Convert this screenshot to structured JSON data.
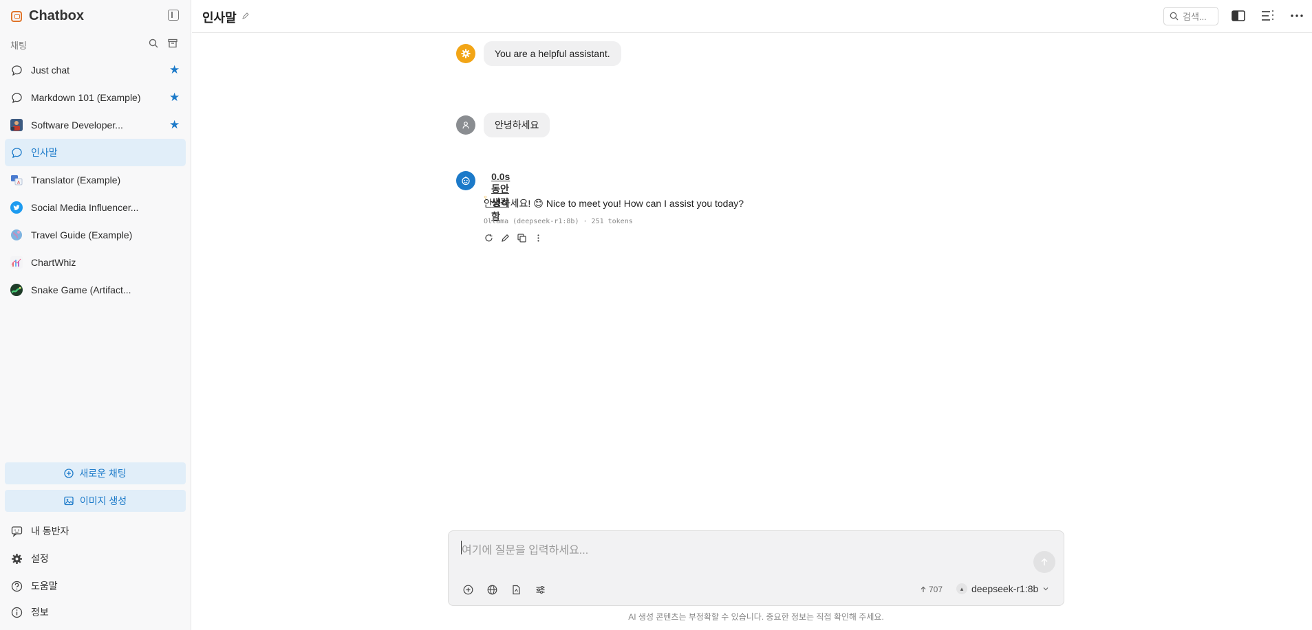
{
  "app": {
    "name": "Chatbox"
  },
  "sidebar": {
    "section_label": "채팅",
    "chats": [
      {
        "label": "Just chat",
        "icon": "chat-bubble-icon",
        "starred": true,
        "active": false
      },
      {
        "label": "Markdown 101 (Example)",
        "icon": "chat-bubble-icon",
        "starred": true,
        "active": false
      },
      {
        "label": "Software Developer...",
        "icon": "developer-avatar-icon",
        "starred": true,
        "active": false
      },
      {
        "label": "인사말",
        "icon": "chat-bubble-icon",
        "starred": false,
        "active": true
      },
      {
        "label": "Translator (Example)",
        "icon": "translator-avatar-icon",
        "starred": false,
        "active": false
      },
      {
        "label": "Social Media Influencer...",
        "icon": "twitter-avatar-icon",
        "starred": false,
        "active": false
      },
      {
        "label": "Travel Guide (Example)",
        "icon": "globe-avatar-icon",
        "starred": false,
        "active": false
      },
      {
        "label": "ChartWhiz",
        "icon": "chart-avatar-icon",
        "starred": false,
        "active": false
      },
      {
        "label": "Snake Game (Artifact...",
        "icon": "snake-avatar-icon",
        "starred": false,
        "active": false
      }
    ],
    "new_chat_label": "새로운 채팅",
    "image_gen_label": "이미지 생성",
    "bottom": {
      "companions": "내 동반자",
      "settings": "설정",
      "help": "도움말",
      "about": "정보"
    }
  },
  "header": {
    "title": "인사말",
    "search_placeholder": "검색..."
  },
  "messages": {
    "system": "You are a helpful assistant.",
    "user": "안녕하세요",
    "assistant": {
      "thinking": "0.0s 동안 생각함",
      "reply_prefix": "안녕하세요!",
      "reply_emoji": "😊",
      "reply_suffix": "Nice to meet you! How can I assist you today?",
      "meta": "Ollama (deepseek-r1:8b) · 251 tokens"
    }
  },
  "input": {
    "placeholder": "여기에 질문을 입력하세요...",
    "token_count": "707",
    "model": "deepseek-r1:8b",
    "disclaimer": "AI 생성 콘텐츠는 부정확할 수 있습니다. 중요한 정보는 직접 확인해 주세요."
  },
  "colors": {
    "accent": "#1c7ac9",
    "active_bg": "#e1eef9",
    "system_avatar": "#f2a516",
    "user_avatar": "#8a8d91",
    "assistant_avatar": "#1c7ac9"
  }
}
